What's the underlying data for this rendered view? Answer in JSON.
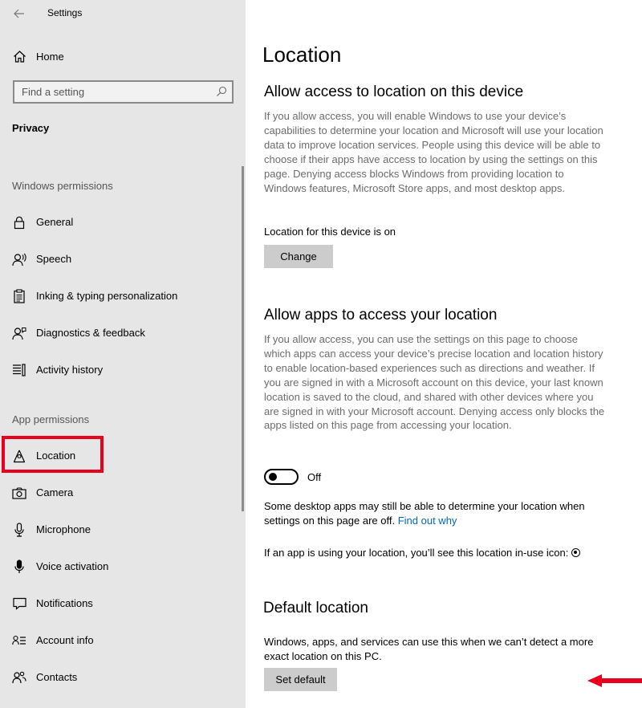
{
  "window": {
    "title": "Settings"
  },
  "sidebar": {
    "home_label": "Home",
    "search_placeholder": "Find a setting",
    "section": "Privacy",
    "windows_permissions_header": "Windows permissions",
    "windows_permissions": [
      {
        "label": "General",
        "icon": "lock-icon"
      },
      {
        "label": "Speech",
        "icon": "speech-icon"
      },
      {
        "label": "Inking & typing personalization",
        "icon": "clipboard-icon"
      },
      {
        "label": "Diagnostics & feedback",
        "icon": "feedback-icon"
      },
      {
        "label": "Activity history",
        "icon": "activity-history-icon"
      }
    ],
    "app_permissions_header": "App permissions",
    "app_permissions": [
      {
        "label": "Location",
        "icon": "location-icon",
        "selected": true
      },
      {
        "label": "Camera",
        "icon": "camera-icon"
      },
      {
        "label": "Microphone",
        "icon": "microphone-icon"
      },
      {
        "label": "Voice activation",
        "icon": "voice-activation-icon"
      },
      {
        "label": "Notifications",
        "icon": "notifications-icon"
      },
      {
        "label": "Account info",
        "icon": "account-info-icon"
      },
      {
        "label": "Contacts",
        "icon": "contacts-icon"
      }
    ]
  },
  "main": {
    "page_title": "Location",
    "device_access": {
      "heading": "Allow access to location on this device",
      "description": "If you allow access, you will enable Windows to use your device’s capabilities to determine your location and Microsoft will use your location data to improve location services. People using this device will be able to choose if their apps have access to location by using the settings on this page. Denying access blocks Windows from providing location to Windows features, Microsoft Store apps, and most desktop apps.",
      "status": "Location for this device is on",
      "button": "Change"
    },
    "app_access": {
      "heading": "Allow apps to access your location",
      "description": "If you allow access, you can use the settings on this page to choose which apps can access your device’s precise location and location history to enable location-based experiences such as directions and weather. If you are signed in with a Microsoft account on this device, your last known location is saved to the cloud, and shared with other devices where you are signed in with your Microsoft account. Denying access only blocks the apps listed on this page from accessing your location.",
      "toggle_state": "Off",
      "note": "Some desktop apps may still be able to determine your location when settings on this page are off.",
      "note_link": "Find out why",
      "inuse_text": "If an app is using your location, you’ll see this location in-use icon:"
    },
    "default_location": {
      "heading": "Default location",
      "description": "Windows, apps, and services can use this when we can’t detect a more exact location on this PC.",
      "button": "Set default"
    }
  },
  "colors": {
    "sidebar_bg": "#e6e6e6",
    "accent_link": "#0067c0",
    "highlight": "#e8001c"
  }
}
